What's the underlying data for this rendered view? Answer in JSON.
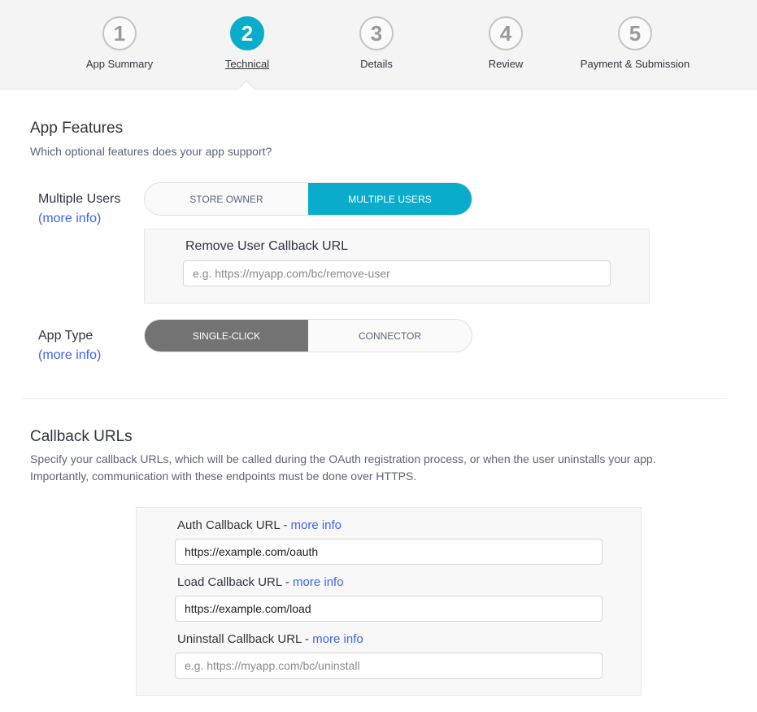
{
  "stepper": {
    "steps": [
      {
        "number": "1",
        "label": "App Summary"
      },
      {
        "number": "2",
        "label": "Technical"
      },
      {
        "number": "3",
        "label": "Details"
      },
      {
        "number": "4",
        "label": "Review"
      },
      {
        "number": "5",
        "label": "Payment & Submission"
      }
    ],
    "active_step": 2,
    "active_color": "#0aaccb"
  },
  "app_features": {
    "title": "App Features",
    "description": "Which optional features does your app support?",
    "multiple_users": {
      "label": "Multiple Users",
      "more_info": "(more info)",
      "options": [
        "STORE OWNER",
        "MULTIPLE USERS"
      ],
      "selected": "MULTIPLE USERS",
      "remove_user_callback": {
        "label": "Remove User Callback URL",
        "value": "",
        "placeholder": "e.g. https://myapp.com/bc/remove-user"
      }
    },
    "app_type": {
      "label": "App Type",
      "more_info": "(more info)",
      "options": [
        "SINGLE-CLICK",
        "CONNECTOR"
      ],
      "selected": "SINGLE-CLICK"
    }
  },
  "callback_urls": {
    "title": "Callback URLs",
    "description_line1": "Specify your callback URLs, which will be called during the OAuth registration process, or when the user uninstalls your app.",
    "description_line2": "Importantly, communication with these endpoints must be done over HTTPS.",
    "auth": {
      "label": "Auth Callback URL - ",
      "more_info": "more info",
      "value": "https://example.com/oauth",
      "placeholder": ""
    },
    "load": {
      "label": "Load Callback URL - ",
      "more_info": "more info",
      "value": "https://example.com/load",
      "placeholder": ""
    },
    "uninstall": {
      "label": "Uninstall Callback URL - ",
      "more_info": "more info",
      "value": "",
      "placeholder": "e.g. https://myapp.com/bc/uninstall"
    }
  }
}
